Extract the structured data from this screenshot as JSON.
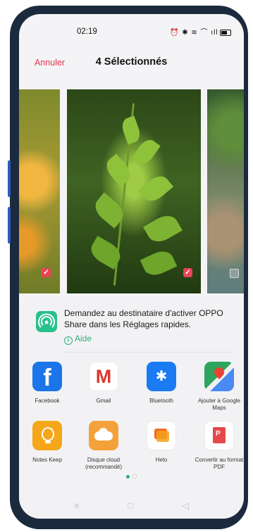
{
  "status_bar": {
    "time": "02:19",
    "icons": [
      "alarm-icon",
      "bluetooth-icon",
      "wifi-icon",
      "signal-icon",
      "battery-icon"
    ],
    "icon_glyphs": "⏰ ✱ ≋ ⌒ ıll"
  },
  "header": {
    "cancel_label": "Annuler",
    "title": "4 Sélectionnés"
  },
  "photos": [
    {
      "name": "photo-yellow-flowers",
      "selected": true
    },
    {
      "name": "photo-green-plant",
      "selected": true
    },
    {
      "name": "photo-aerial-coast",
      "selected": false
    }
  ],
  "share_sheet": {
    "oppo_share_text": "Demandez au destinataire d'activer OPPO Share dans les Réglages rapides.",
    "help_label": "Aide",
    "apps_row1": [
      {
        "label": "Facebook",
        "icon": "facebook-icon"
      },
      {
        "label": "Gmail",
        "icon": "gmail-icon"
      },
      {
        "label": "Bluetooth",
        "icon": "bluetooth-icon"
      },
      {
        "label": "Ajouter à Google Maps",
        "icon": "google-maps-icon"
      }
    ],
    "apps_row2": [
      {
        "label": "Notes Keep",
        "icon": "keep-notes-icon"
      },
      {
        "label": "Disque cloud (recommandé)",
        "icon": "cloud-drive-icon"
      },
      {
        "label": "Helo",
        "icon": "helo-icon"
      },
      {
        "label": "Convertir au format PDF",
        "icon": "pdf-icon"
      }
    ],
    "page_indicator": {
      "current": 1,
      "total": 2
    }
  },
  "icon_glyphs": {
    "facebook": "f",
    "gmail": "M",
    "bluetooth": "✱",
    "pdf": "P",
    "nav_menu": "≡",
    "nav_home": "□",
    "nav_back": "◁",
    "check": "✓"
  },
  "colors": {
    "accent_red": "#e0364d",
    "accent_green": "#2cae7c",
    "sheet_bg": "#f2f2f4"
  }
}
